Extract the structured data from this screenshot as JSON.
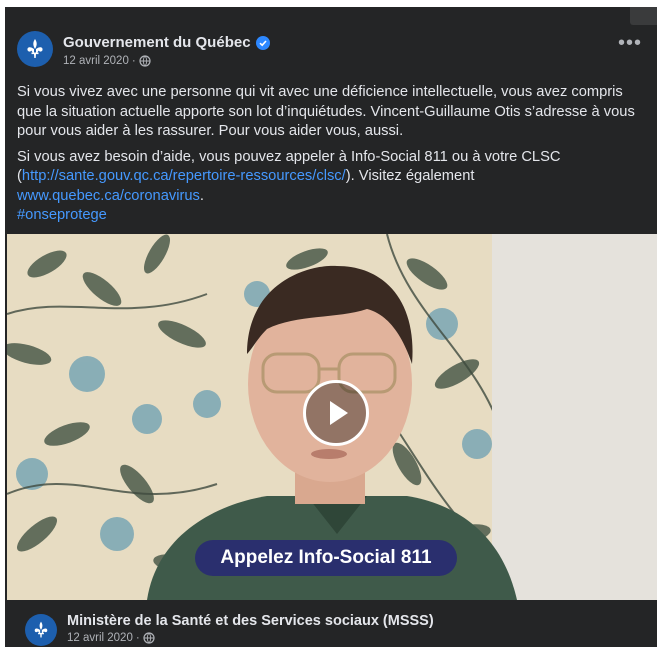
{
  "post": {
    "author": "Gouvernement du Québec",
    "date": "12 avril 2020",
    "separator": "·",
    "menu_label": "•••",
    "paragraph1": "Si vous vivez avec une personne qui vit avec une déficience intellectuelle, vous avez compris que la situation actuelle apporte son lot d’inquiétudes. Vincent-Guillaume Otis s’adresse à vous pour vous aider à les rassurer. Pour vous aider vous, aussi.",
    "p2_part1": "Si vous avez besoin d’aide, vous pouvez appeler à Info-Social 811 ou à votre CLSC (",
    "p2_link1": "http://sante.gouv.qc.ca/repertoire-ressources/clsc/",
    "p2_part2": "). Visitez également",
    "p2_link2": "www.quebec.ca/coronavirus",
    "p2_part3": ".",
    "hashtag": "#onseprotege"
  },
  "video": {
    "caption": "Appelez Info-Social 811"
  },
  "shared_from": {
    "author": "Ministère de la Santé et des Services sociaux (MSSS)",
    "date": "12 avril 2020",
    "separator": "·"
  },
  "colors": {
    "background": "#242526",
    "text": "#e4e6eb",
    "link": "#4599ff",
    "caption_bg": "#2a2f6e",
    "avatar": "#1d5fae"
  },
  "icons": [
    "fleur-de-lis-icon",
    "verified-badge-icon",
    "globe-icon",
    "more-options-icon",
    "play-icon"
  ]
}
